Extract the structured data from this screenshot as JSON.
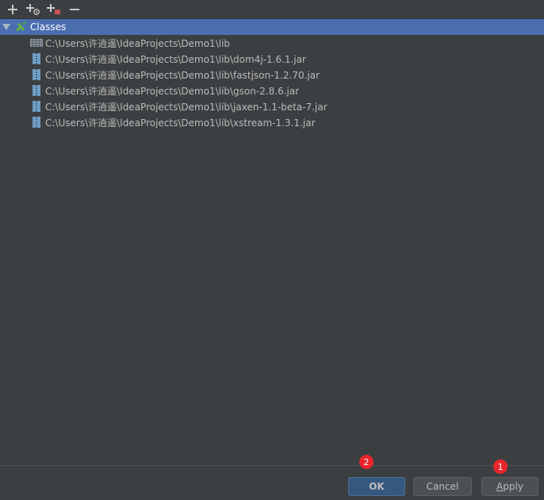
{
  "toolbar": {
    "buttons": [
      {
        "name": "add-icon"
      },
      {
        "name": "add-jar-directory-icon"
      },
      {
        "name": "add-url-icon"
      },
      {
        "name": "remove-icon"
      }
    ]
  },
  "tree": {
    "root": {
      "label": "Classes",
      "icon": "library-classes-icon",
      "expanded": true
    },
    "items": [
      {
        "path": "C:\\Users\\许逍遥\\IdeaProjects\\Demo1\\lib",
        "icon": "folder-icon"
      },
      {
        "path": "C:\\Users\\许逍遥\\IdeaProjects\\Demo1\\lib\\dom4j-1.6.1.jar",
        "icon": "jar-icon"
      },
      {
        "path": "C:\\Users\\许逍遥\\IdeaProjects\\Demo1\\lib\\fastjson-1.2.70.jar",
        "icon": "jar-icon"
      },
      {
        "path": "C:\\Users\\许逍遥\\IdeaProjects\\Demo1\\lib\\gson-2.8.6.jar",
        "icon": "jar-icon"
      },
      {
        "path": "C:\\Users\\许逍遥\\IdeaProjects\\Demo1\\lib\\jaxen-1.1-beta-7.jar",
        "icon": "jar-icon"
      },
      {
        "path": "C:\\Users\\许逍遥\\IdeaProjects\\Demo1\\lib\\xstream-1.3.1.jar",
        "icon": "jar-icon"
      }
    ]
  },
  "footer": {
    "ok_label": "OK",
    "cancel_label": "Cancel",
    "apply_mnemonic": "A",
    "apply_rest": "pply"
  },
  "annotations": {
    "badge_1": "1",
    "badge_2": "2"
  },
  "colors": {
    "background": "#3c3f41",
    "selection": "#4b6eaf",
    "default_button": "#365880",
    "badge": "#e8262c"
  }
}
